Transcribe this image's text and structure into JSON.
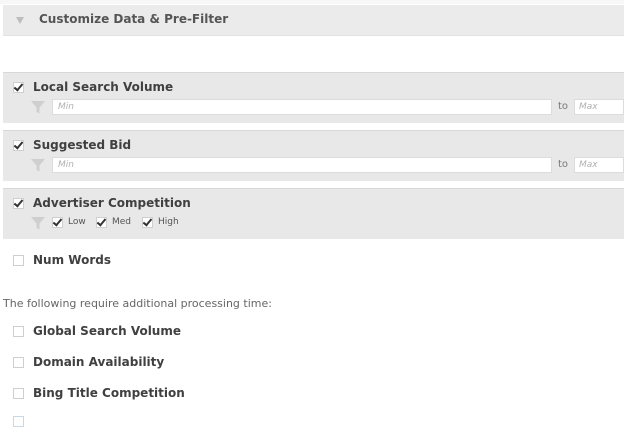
{
  "header": {
    "title": "Customize Data & Pre-Filter",
    "toggle_icon": "triangle-down-icon"
  },
  "filters": [
    {
      "label": "Local Search Volume",
      "checked": true,
      "min_placeholder": "Min",
      "to": "to",
      "max_placeholder": "Max"
    },
    {
      "label": "Suggested Bid",
      "checked": true,
      "min_placeholder": "Min",
      "to": "to",
      "max_placeholder": "Max"
    },
    {
      "label": "Advertiser Competition",
      "checked": true,
      "options": [
        {
          "label": "Low",
          "checked": true
        },
        {
          "label": "Med",
          "checked": true
        },
        {
          "label": "High",
          "checked": true
        }
      ]
    }
  ],
  "num_words": {
    "label": "Num Words",
    "checked": false
  },
  "processing_note": "The following require additional processing time:",
  "extra_options": [
    {
      "label": "Global Search Volume",
      "checked": false
    },
    {
      "label": "Domain Availability",
      "checked": false
    },
    {
      "label": "Bing Title Competition",
      "checked": false
    }
  ],
  "colors": {
    "panel_bg": "#e8e8e8",
    "header_bg": "#ebebeb",
    "text": "#404040"
  }
}
